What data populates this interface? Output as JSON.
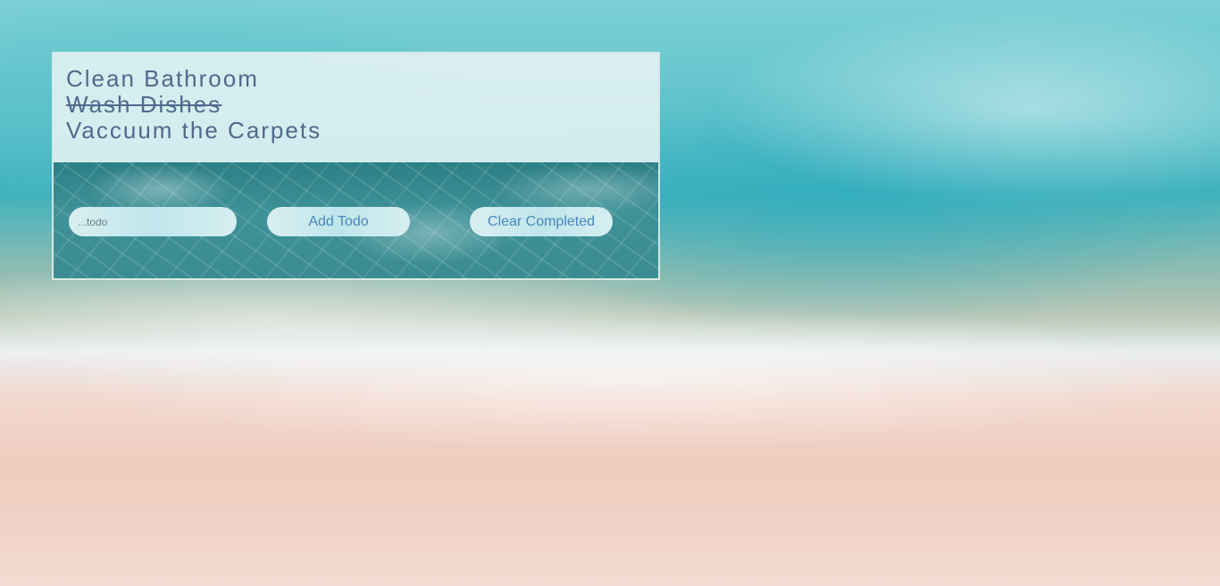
{
  "todos": [
    {
      "text": "Clean Bathroom",
      "completed": false
    },
    {
      "text": "Wash Dishes",
      "completed": true
    },
    {
      "text": "Vaccuum the Carpets",
      "completed": false
    }
  ],
  "input": {
    "placeholder": "...todo",
    "value": ""
  },
  "buttons": {
    "add_label": "Add Todo",
    "clear_label": "Clear Completed"
  },
  "colors": {
    "text": "#4e6b8d",
    "button_text": "#4a86bd"
  }
}
